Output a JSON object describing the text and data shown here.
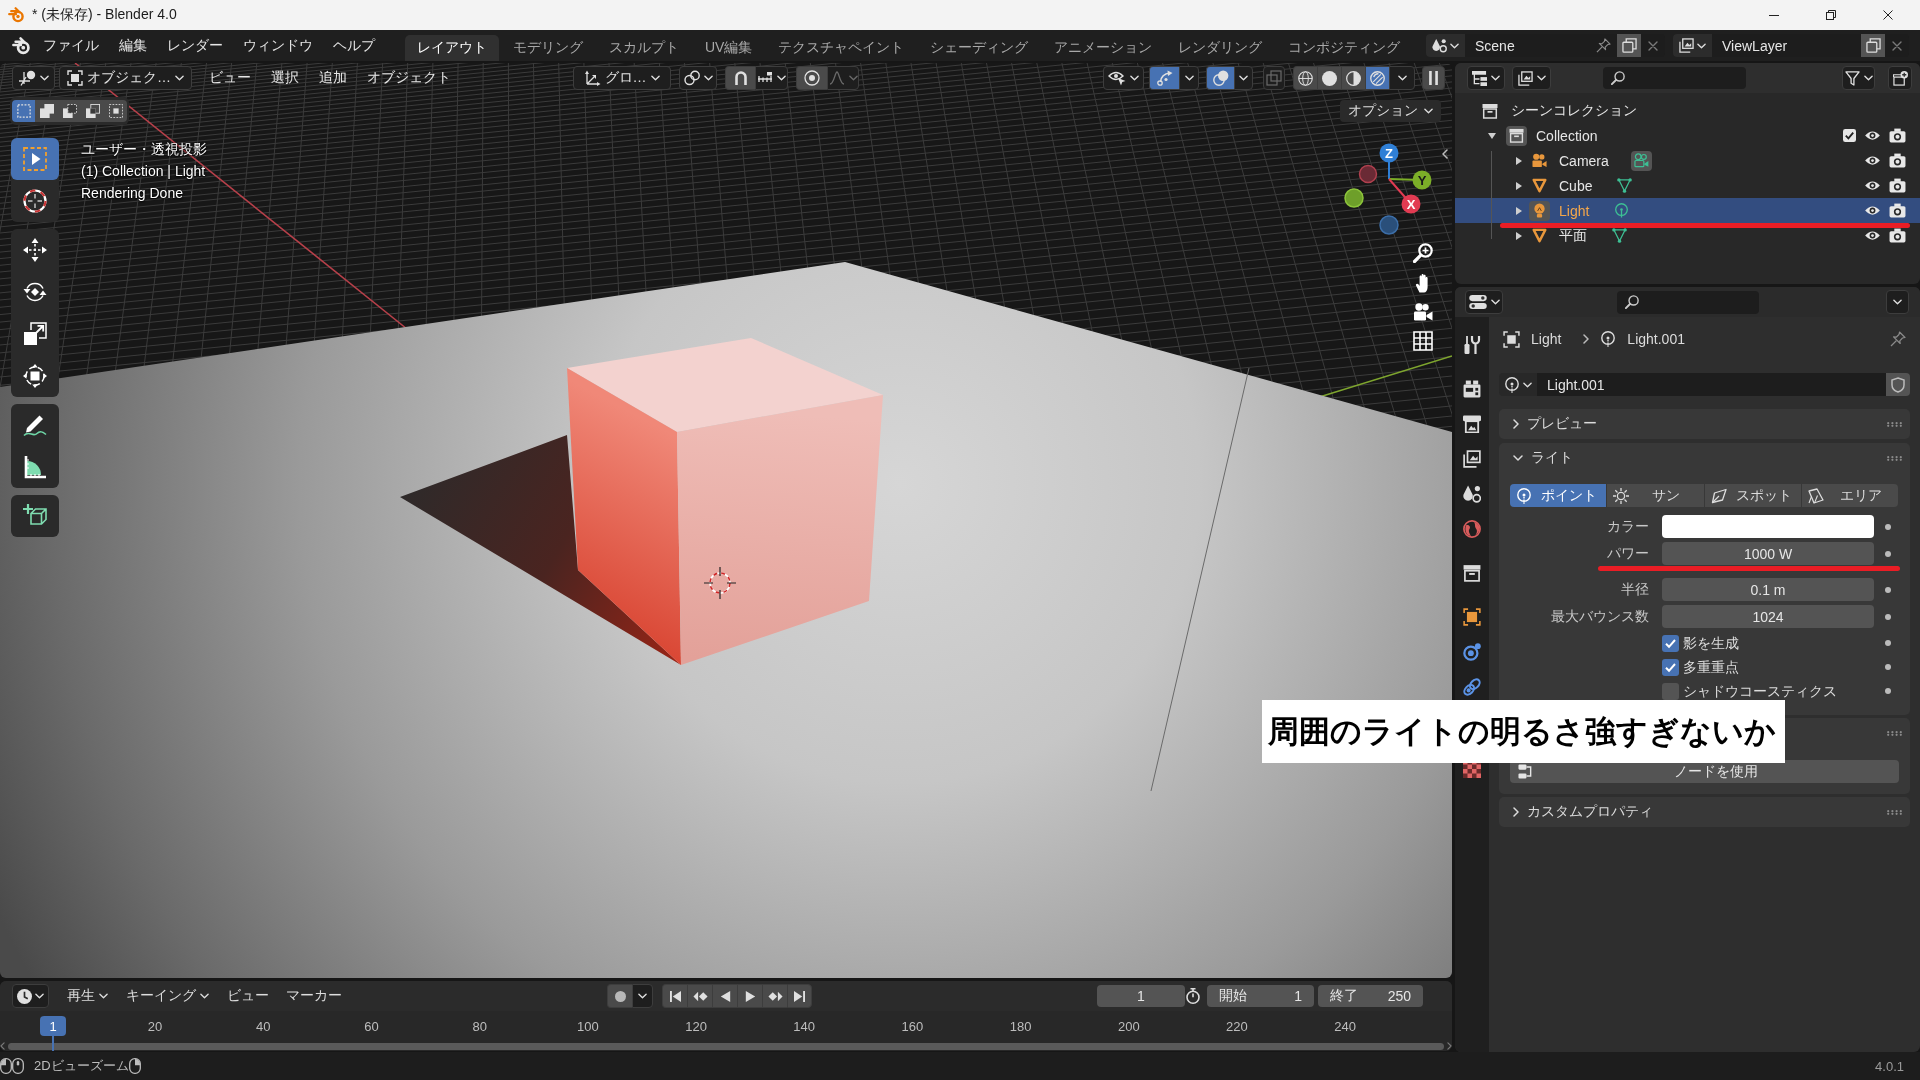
{
  "window": {
    "title": "* (未保存) - Blender 4.0"
  },
  "topbar": {
    "menus": [
      "ファイル",
      "編集",
      "レンダー",
      "ウィンドウ",
      "ヘルプ"
    ],
    "workspaces": [
      {
        "label": "レイアウト",
        "selected": true
      },
      {
        "label": "モデリング",
        "selected": false
      },
      {
        "label": "スカルプト",
        "selected": false
      },
      {
        "label": "UV編集",
        "selected": false
      },
      {
        "label": "テクスチャペイント",
        "selected": false
      },
      {
        "label": "シェーディング",
        "selected": false
      },
      {
        "label": "アニメーション",
        "selected": false
      },
      {
        "label": "レンダリング",
        "selected": false
      },
      {
        "label": "コンポジティング",
        "selected": false
      }
    ],
    "scene": "Scene",
    "view_layer": "ViewLayer"
  },
  "viewport": {
    "header": {
      "mode": "オブジェク…",
      "menus": [
        "ビュー",
        "選択",
        "追加",
        "オブジェクト"
      ],
      "orientation": "グロ…",
      "toggles": [
        {
          "kind": "snap",
          "on": false
        },
        {
          "kind": "proportional",
          "on": false
        },
        {
          "kind": "gizmo",
          "on": true
        },
        {
          "kind": "overlay",
          "on": true
        },
        {
          "kind": "xray",
          "on": false
        }
      ],
      "shading": [
        {
          "kind": "wireframe",
          "selected": false
        },
        {
          "kind": "solid",
          "selected": false
        },
        {
          "kind": "material",
          "selected": false
        },
        {
          "kind": "rendered",
          "selected": true
        }
      ]
    },
    "select_modes": [
      {
        "kind": "set",
        "selected": true
      },
      {
        "kind": "extend",
        "selected": false
      },
      {
        "kind": "subtract",
        "selected": false
      },
      {
        "kind": "invert",
        "selected": false
      },
      {
        "kind": "intersect",
        "selected": false
      }
    ],
    "options": "オプション",
    "info": [
      "ユーザー・透視投影",
      "(1) Collection | Light",
      "Rendering Done"
    ],
    "tools": [
      [
        {
          "kind": "select_box",
          "selected": true
        },
        {
          "kind": "cursor",
          "selected": false
        }
      ],
      [
        {
          "kind": "move",
          "selected": false
        },
        {
          "kind": "rotate",
          "selected": false
        },
        {
          "kind": "scale",
          "selected": false
        },
        {
          "kind": "transform",
          "selected": false
        }
      ],
      [
        {
          "kind": "annotate",
          "selected": false
        },
        {
          "kind": "measure",
          "selected": false
        }
      ],
      [
        {
          "kind": "add_cube",
          "selected": false
        }
      ]
    ],
    "gizmo_axes": [
      {
        "kind": "z",
        "label": "Z"
      },
      {
        "kind": "y",
        "label": "Y"
      },
      {
        "kind": "x",
        "label": "X"
      }
    ]
  },
  "outliner": {
    "root": "シーンコレクション",
    "collections": [
      {
        "name": "Collection",
        "expanded": true,
        "active": true,
        "selected": false,
        "checked": true,
        "visible": true,
        "children": [
          {
            "name": "Camera",
            "kind": "camera",
            "expanded": false,
            "selected": false,
            "visible": true,
            "data_active": true,
            "underlined": false
          },
          {
            "name": "Cube",
            "kind": "mesh",
            "expanded": false,
            "selected": false,
            "visible": true,
            "data_active": false,
            "underlined": false
          },
          {
            "name": "Light",
            "kind": "light",
            "expanded": false,
            "selected": true,
            "visible": true,
            "data_active": false,
            "underlined": true
          },
          {
            "name": "平面",
            "kind": "mesh",
            "expanded": false,
            "selected": false,
            "visible": true,
            "data_active": false,
            "underlined": false
          }
        ]
      }
    ]
  },
  "properties": {
    "tab_groups": [
      [
        {
          "kind": "tool",
          "selected": false
        }
      ],
      [
        {
          "kind": "render",
          "selected": false
        },
        {
          "kind": "output",
          "selected": false
        },
        {
          "kind": "view_layer",
          "selected": false
        },
        {
          "kind": "scene",
          "selected": false
        },
        {
          "kind": "world",
          "selected": false
        }
      ],
      [
        {
          "kind": "collection",
          "selected": false
        }
      ],
      [
        {
          "kind": "object",
          "selected": false
        },
        {
          "kind": "physics",
          "selected": false
        },
        {
          "kind": "constraints",
          "selected": false
        }
      ],
      [
        {
          "kind": "texture",
          "selected": false
        }
      ]
    ],
    "breadcrumb": [
      "Light",
      "Light.001"
    ],
    "datablock": "Light.001",
    "panels": [
      {
        "kind": "section",
        "title": "プレビュー",
        "expanded": false
      },
      {
        "kind": "light",
        "title": "ライト",
        "expanded": true,
        "types": [
          {
            "kind": "point",
            "label": "ポイント",
            "selected": true
          },
          {
            "kind": "sun",
            "label": "サン",
            "selected": false
          },
          {
            "kind": "spot",
            "label": "スポット",
            "selected": false
          },
          {
            "kind": "area",
            "label": "エリア",
            "selected": false
          }
        ],
        "groups": [
          [
            {
              "kind": "color",
              "label": "カラー",
              "color": "#ffffff",
              "underlined": false
            },
            {
              "kind": "number",
              "label": "パワー",
              "value": "1000 W",
              "underlined": true
            }
          ],
          [
            {
              "kind": "number",
              "label": "半径",
              "value": "0.1 m",
              "underlined": false
            },
            {
              "kind": "number",
              "label": "最大バウンス数",
              "value": "1024",
              "underlined": false
            }
          ],
          [
            {
              "kind": "checkbox",
              "label": "影を生成",
              "checked": true,
              "underlined": false
            },
            {
              "kind": "checkbox",
              "label": "多重重点",
              "checked": true,
              "underlined": false
            },
            {
              "kind": "checkbox",
              "label": "シャドウコースティクス",
              "checked": false,
              "underlined": false
            }
          ]
        ]
      },
      {
        "kind": "nodes",
        "button": "ノードを使用"
      },
      {
        "kind": "section",
        "title": "カスタムプロパティ",
        "expanded": false
      }
    ]
  },
  "timeline": {
    "menus": [
      {
        "kind": "dropdown",
        "label": "再生"
      },
      {
        "kind": "dropdown",
        "label": "キーイング"
      },
      {
        "kind": "menu",
        "label": "ビュー"
      },
      {
        "kind": "menu",
        "label": "マーカー"
      }
    ],
    "auto_keying": false,
    "current_frame": "1",
    "start": {
      "label": "開始",
      "value": "1"
    },
    "end": {
      "label": "終了",
      "value": "250"
    },
    "ruler": [
      "20",
      "40",
      "60",
      "80",
      "100",
      "120",
      "140",
      "160",
      "180",
      "200",
      "220",
      "240"
    ],
    "playhead": "1"
  },
  "status_bar": {
    "hint": "2Dビューズーム",
    "version": "4.0.1"
  },
  "caption": "周囲のライトの明るさ強すぎないか"
}
